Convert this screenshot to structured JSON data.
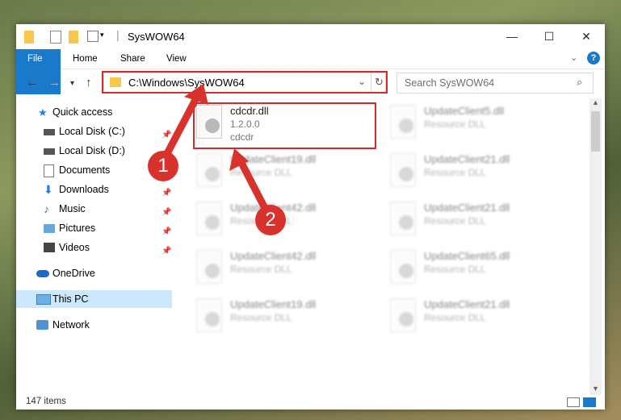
{
  "window": {
    "title": "SysWOW64"
  },
  "ribbon": {
    "tabs": [
      "File",
      "Home",
      "Share",
      "View"
    ]
  },
  "nav": {
    "address": "C:\\Windows\\SysWOW64",
    "search_placeholder": "Search SysWOW64"
  },
  "sidebar": {
    "items": [
      {
        "label": "Quick access",
        "icon": "star-icon"
      },
      {
        "label": "Local Disk (C:)",
        "icon": "drive-icon"
      },
      {
        "label": "Local Disk (D:)",
        "icon": "drive-icon"
      },
      {
        "label": "Documents",
        "icon": "documents-icon"
      },
      {
        "label": "Downloads",
        "icon": "download-icon"
      },
      {
        "label": "Music",
        "icon": "music-icon"
      },
      {
        "label": "Pictures",
        "icon": "pictures-icon"
      },
      {
        "label": "Videos",
        "icon": "videos-icon"
      },
      {
        "label": "OneDrive",
        "icon": "cloud-icon"
      },
      {
        "label": "This PC",
        "icon": "computer-icon"
      },
      {
        "label": "Network",
        "icon": "network-icon"
      }
    ]
  },
  "files": [
    {
      "name": "cdcdr.dll",
      "line2": "1.2.0.0",
      "line3": "cdcdr"
    },
    {
      "name": "UpdateClient5.dll",
      "line2": "Resource DLL"
    },
    {
      "name": "UpdateClient19.dll",
      "line2": "Resource DLL"
    },
    {
      "name": "UpdateClient21.dll",
      "line2": "Resource DLL"
    },
    {
      "name": "UpdateClient42.dll",
      "line2": "Resource DLL"
    },
    {
      "name": "UpdateClient21.dll",
      "line2": "Resource DLL"
    },
    {
      "name": "UpdateClient42.dll",
      "line2": "Resource DLL"
    },
    {
      "name": "UpdateClient65.dll",
      "line2": "Resource DLL"
    },
    {
      "name": "UpdateClient19.dll",
      "line2": "Resource DLL"
    },
    {
      "name": "UpdateClient21.dll",
      "line2": "Resource DLL"
    }
  ],
  "status": {
    "count": "147 items"
  },
  "callouts": [
    "1",
    "2"
  ],
  "colors": {
    "accent": "#1979ca",
    "highlight": "#d12b2b",
    "selected": "#cce8ff"
  }
}
